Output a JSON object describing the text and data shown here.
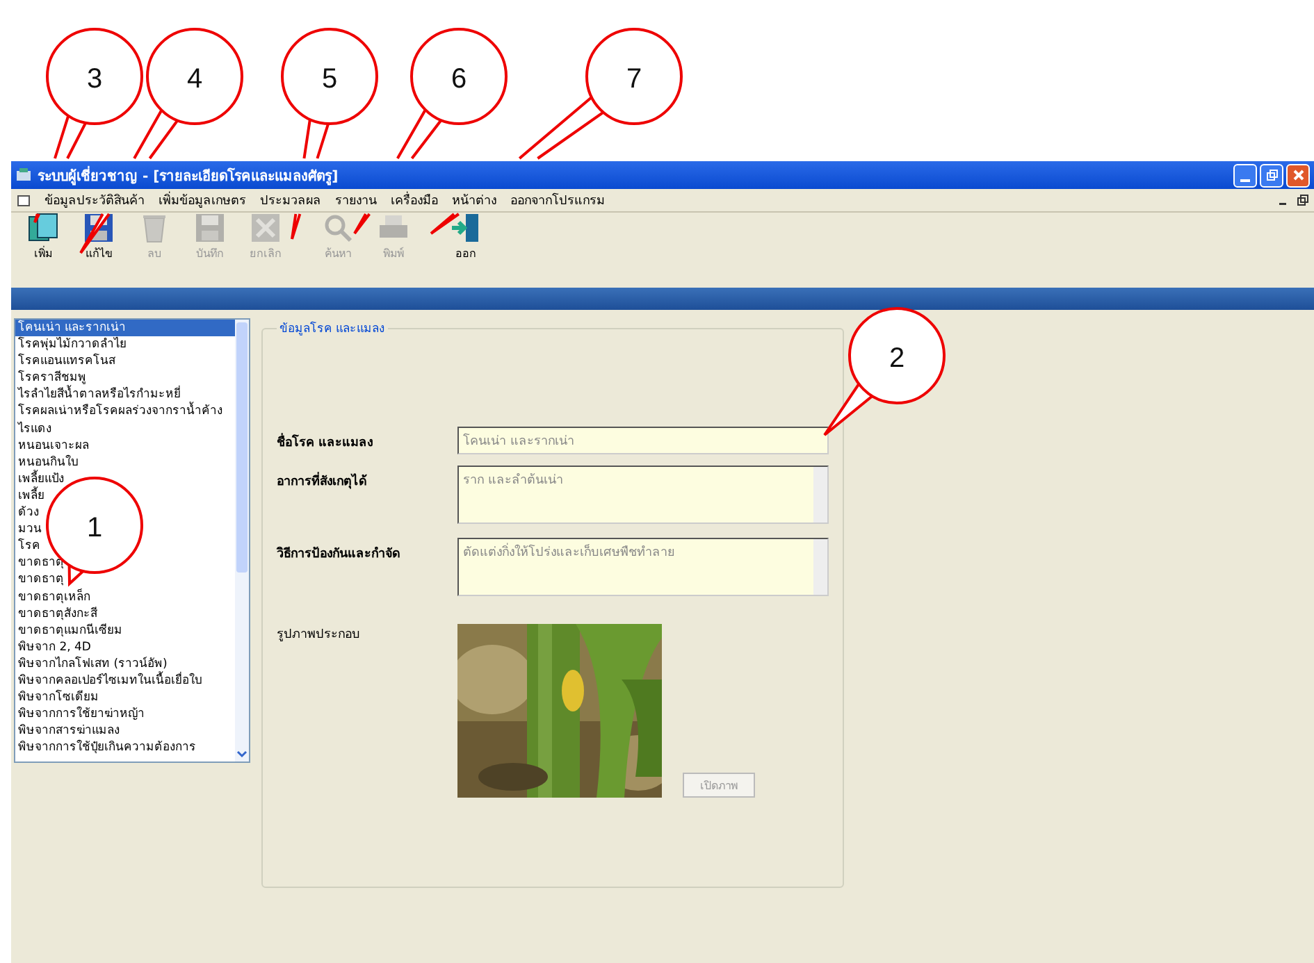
{
  "callouts": [
    {
      "label": "3"
    },
    {
      "label": "4"
    },
    {
      "label": "5"
    },
    {
      "label": "6"
    },
    {
      "label": "7"
    },
    {
      "label": "2"
    },
    {
      "label": "1"
    }
  ],
  "window": {
    "title": "ระบบผู้เชี่ยวชาญ - [รายละเอียดโรคและแมลงศัตรู]"
  },
  "menu": [
    "ข้อมูลประวัติสินค้า",
    "เพิ่มข้อมูลเกษตร",
    "ประมวลผล",
    "รายงาน",
    "เครื่องมือ",
    "หน้าต่าง",
    "ออกจากโปรแกรม"
  ],
  "toolbar": [
    {
      "kind": "add",
      "label": "เพิ่ม",
      "disabled": false
    },
    {
      "kind": "edit",
      "label": "แก้ไข",
      "disabled": false
    },
    {
      "kind": "delete",
      "label": "ลบ",
      "disabled": true
    },
    {
      "kind": "save",
      "label": "บันทึก",
      "disabled": true
    },
    {
      "kind": "cancel",
      "label": "ยกเลิก",
      "disabled": true
    },
    {
      "kind": "search",
      "label": "ค้นหา",
      "disabled": true
    },
    {
      "kind": "print",
      "label": "พิมพ์",
      "disabled": true
    },
    {
      "kind": "exit",
      "label": "ออก",
      "disabled": false
    }
  ],
  "disease_list": [
    {
      "text": "โคนเน่า และรากเน่า",
      "selected": true
    },
    {
      "text": "โรคพุ่มไม้กวาดลำไย",
      "selected": false
    },
    {
      "text": "โรคแอนแทรคโนส",
      "selected": false
    },
    {
      "text": "โรคราสีชมพู",
      "selected": false
    },
    {
      "text": "ไรลำไยสีน้ำตาลหรือไรกำมะหยี่",
      "selected": false
    },
    {
      "text": "โรคผลเน่าหรือโรคผลร่วงจากราน้ำค้าง",
      "selected": false
    },
    {
      "text": "ไรแดง",
      "selected": false
    },
    {
      "text": "หนอนเจาะผล",
      "selected": false
    },
    {
      "text": "หนอนกินใบ",
      "selected": false
    },
    {
      "text": "เพลี้ยแป้ง",
      "selected": false
    },
    {
      "text": "เพลี้ย",
      "selected": false
    },
    {
      "text": "ด้วง",
      "selected": false
    },
    {
      "text": "มวน",
      "selected": false
    },
    {
      "text": "โรค",
      "selected": false
    },
    {
      "text": "ขาดธาตุ",
      "selected": false
    },
    {
      "text": "ขาดธาตุ",
      "selected": false
    },
    {
      "text": "ขาดธาตุเหล็ก",
      "selected": false
    },
    {
      "text": "ขาดธาตุสังกะสี",
      "selected": false
    },
    {
      "text": "ขาดธาตุแมกนีเซียม",
      "selected": false
    },
    {
      "text": "พิษจาก 2, 4D",
      "selected": false
    },
    {
      "text": "พิษจากไกลโฟเสท (ราวน์อัพ)",
      "selected": false
    },
    {
      "text": "พิษจากคลอเปอร์ไซเมทในเนื้อเยื่อใบ",
      "selected": false
    },
    {
      "text": "พิษจากโซเดียม",
      "selected": false
    },
    {
      "text": "พิษจากการใช้ยาฆ่าหญ้า",
      "selected": false
    },
    {
      "text": "พิษจากสารฆ่าแมลง",
      "selected": false
    },
    {
      "text": "พิษจากการใช้ปุ๋ยเกินความต้องการ",
      "selected": false
    }
  ],
  "detail": {
    "group_title": "ข้อมูลโรค และแมลง",
    "fields": [
      {
        "kind": "line",
        "label": "ชื่อโรค และแมลง",
        "value": "โคนเน่า และรากเน่า"
      },
      {
        "kind": "memo",
        "label": "อาการที่สังเกตุได้",
        "value": "ราก และลำต้นเน่า"
      },
      {
        "kind": "memo",
        "label": "วิธีการป้องกันและกำจัด",
        "value": "ตัดแต่งกิ่งให้โปร่งและเก็บเศษพืชทำลาย"
      }
    ],
    "image_label": "รูปภาพประกอบ",
    "image_button": "เปิดภาพ"
  }
}
